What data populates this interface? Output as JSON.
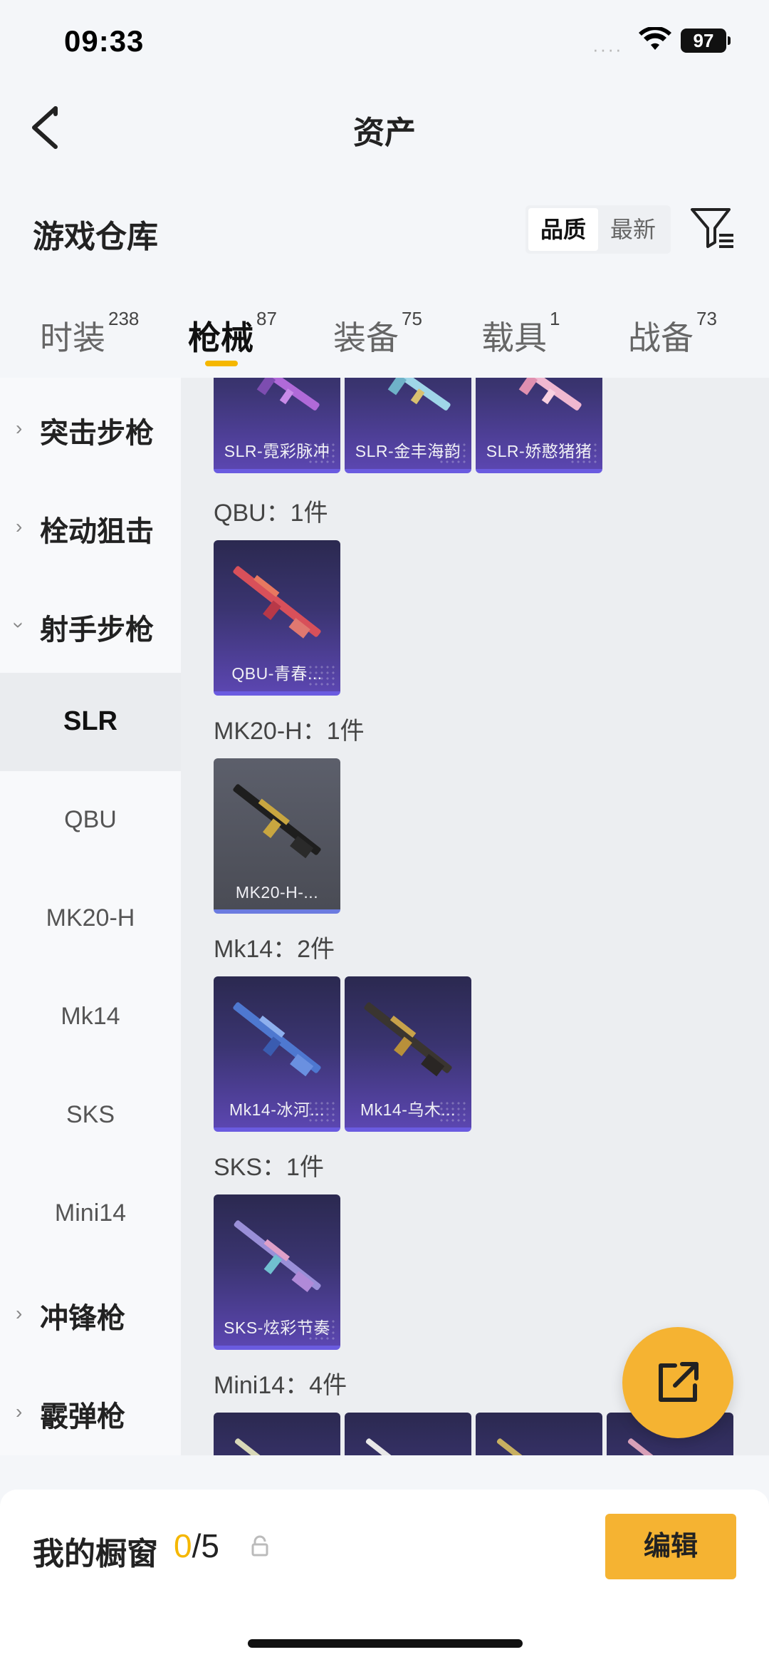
{
  "status": {
    "time": "09:33",
    "battery": "97"
  },
  "nav": {
    "title": "资产"
  },
  "warehouse": {
    "title": "游戏仓库",
    "sort_options": [
      "品质",
      "最新"
    ],
    "sort_selected": "品质"
  },
  "tabs": [
    {
      "label": "时装",
      "count": "238"
    },
    {
      "label": "枪械",
      "count": "87"
    },
    {
      "label": "装备",
      "count": "75"
    },
    {
      "label": "载具",
      "count": "1"
    },
    {
      "label": "战备",
      "count": "73"
    }
  ],
  "active_tab": "枪械",
  "sidebar": {
    "parents": [
      "突击步枪",
      "栓动狙击",
      "射手步枪",
      "冲锋枪",
      "霰弹枪"
    ],
    "children": [
      "SLR",
      "QBU",
      "MK20-H",
      "Mk14",
      "SKS",
      "Mini14"
    ],
    "active_child": "SLR"
  },
  "groups": [
    {
      "label": "",
      "items": [
        "SLR-霓彩脉冲",
        "SLR-金丰海韵",
        "SLR-娇憨猪猪"
      ]
    },
    {
      "label": "QBU：1件",
      "items": [
        "QBU-青春..."
      ]
    },
    {
      "label": "MK20-H：1件",
      "items": [
        "MK20-H-..."
      ]
    },
    {
      "label": "Mk14：2件",
      "items": [
        "Mk14-冰河...",
        "Mk14-乌木..."
      ]
    },
    {
      "label": "SKS：1件",
      "items": [
        "SKS-炫彩节奏"
      ]
    },
    {
      "label": "Mini14：4件",
      "items": [
        "",
        "",
        "",
        ""
      ]
    }
  ],
  "showcase": {
    "label": "我的橱窗",
    "current": "0",
    "total": "/5",
    "edit_label": "编辑"
  },
  "icons": {
    "back": "chevron-left-icon",
    "filter": "filter-icon",
    "share": "external-link-icon",
    "lock": "lock-icon",
    "wifi": "wifi-icon"
  },
  "colors": {
    "accent": "#f5b332",
    "tab_underline": "#f5b700",
    "card_purple": "#5b46b0"
  }
}
